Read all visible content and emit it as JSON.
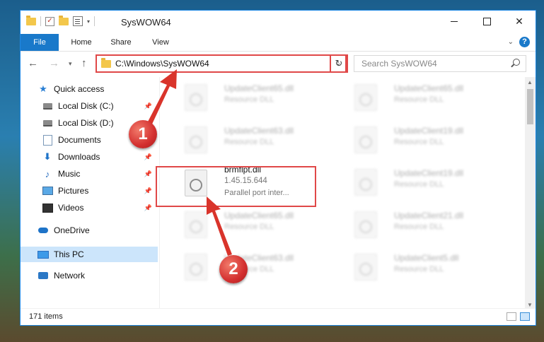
{
  "window": {
    "title": "SysWOW64"
  },
  "ribbon": {
    "tabs": [
      {
        "label": "File"
      },
      {
        "label": "Home"
      },
      {
        "label": "Share"
      },
      {
        "label": "View"
      }
    ]
  },
  "address": {
    "path": "C:\\Windows\\SysWOW64"
  },
  "search": {
    "placeholder": "Search SysWOW64"
  },
  "sidebar": {
    "items": [
      {
        "label": "Quick access",
        "icon": "star-icon"
      },
      {
        "label": "Local Disk (C:)",
        "icon": "drive-icon",
        "pinned": true
      },
      {
        "label": "Local Disk (D:)",
        "icon": "drive-icon"
      },
      {
        "label": "Documents",
        "icon": "documents-icon",
        "pinned": true
      },
      {
        "label": "Downloads",
        "icon": "download-icon",
        "pinned": true
      },
      {
        "label": "Music",
        "icon": "music-icon",
        "pinned": true
      },
      {
        "label": "Pictures",
        "icon": "pictures-icon",
        "pinned": true
      },
      {
        "label": "Videos",
        "icon": "videos-icon",
        "pinned": true
      },
      {
        "label": "OneDrive",
        "icon": "cloud-icon"
      },
      {
        "label": "This PC",
        "icon": "computer-icon",
        "selected": true
      },
      {
        "label": "Network",
        "icon": "network-icon"
      }
    ]
  },
  "files": {
    "left": [
      {
        "name": "UpdateClient65.dll",
        "desc": "Resource DLL"
      },
      {
        "name": "UpdateClient63.dll",
        "desc": "Resource DLL"
      },
      {
        "name": "brmflpt.dll",
        "version": "1.45.15.644",
        "desc": "Parallel port inter..."
      },
      {
        "name": "UpdateClient65.dll",
        "desc": "Resource DLL"
      },
      {
        "name": "UpdateClient63.dll",
        "desc": "Resource DLL"
      }
    ],
    "right": [
      {
        "name": "UpdateClient65.dll",
        "desc": "Resource DLL"
      },
      {
        "name": "UpdateClient19.dll",
        "desc": "Resource DLL"
      },
      {
        "name": "UpdateClient19.dll",
        "desc": "Resource DLL"
      },
      {
        "name": "UpdateClient21.dll",
        "desc": "Resource DLL"
      },
      {
        "name": "UpdateClient5.dll",
        "desc": "Resource DLL"
      }
    ]
  },
  "status": {
    "items_count": "171 items"
  },
  "annotations": {
    "step1": "1",
    "step2": "2",
    "highlight_color": "#e04848"
  }
}
